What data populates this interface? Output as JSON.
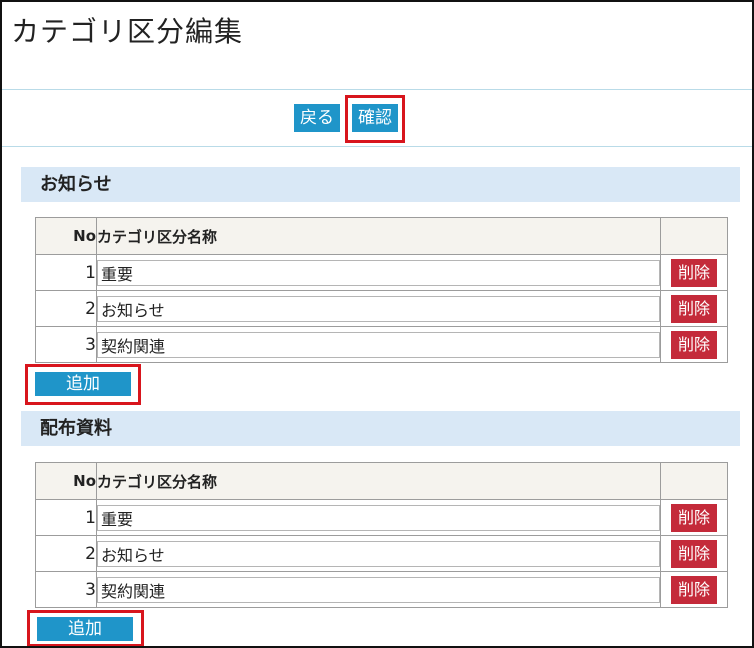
{
  "page": {
    "title": "カテゴリ区分編集"
  },
  "toolbar": {
    "back_label": "戻る",
    "confirm_label": "確認"
  },
  "table_header": {
    "no": "No",
    "name": "カテゴリ区分名称"
  },
  "sections": [
    {
      "title": "お知らせ",
      "rows": [
        {
          "no": "1",
          "name": "重要",
          "delete_label": "削除"
        },
        {
          "no": "2",
          "name": "お知らせ",
          "delete_label": "削除"
        },
        {
          "no": "3",
          "name": "契約関連",
          "delete_label": "削除"
        }
      ],
      "add_label": "追加"
    },
    {
      "title": "配布資料",
      "rows": [
        {
          "no": "1",
          "name": "重要",
          "delete_label": "削除"
        },
        {
          "no": "2",
          "name": "お知らせ",
          "delete_label": "削除"
        },
        {
          "no": "3",
          "name": "契約関連",
          "delete_label": "削除"
        }
      ],
      "add_label": "追加"
    }
  ],
  "colors": {
    "button_blue": "#1f95c9",
    "delete_red": "#c42a3a",
    "section_bar": "#d9e8f6",
    "highlight_red": "#d8151d"
  }
}
